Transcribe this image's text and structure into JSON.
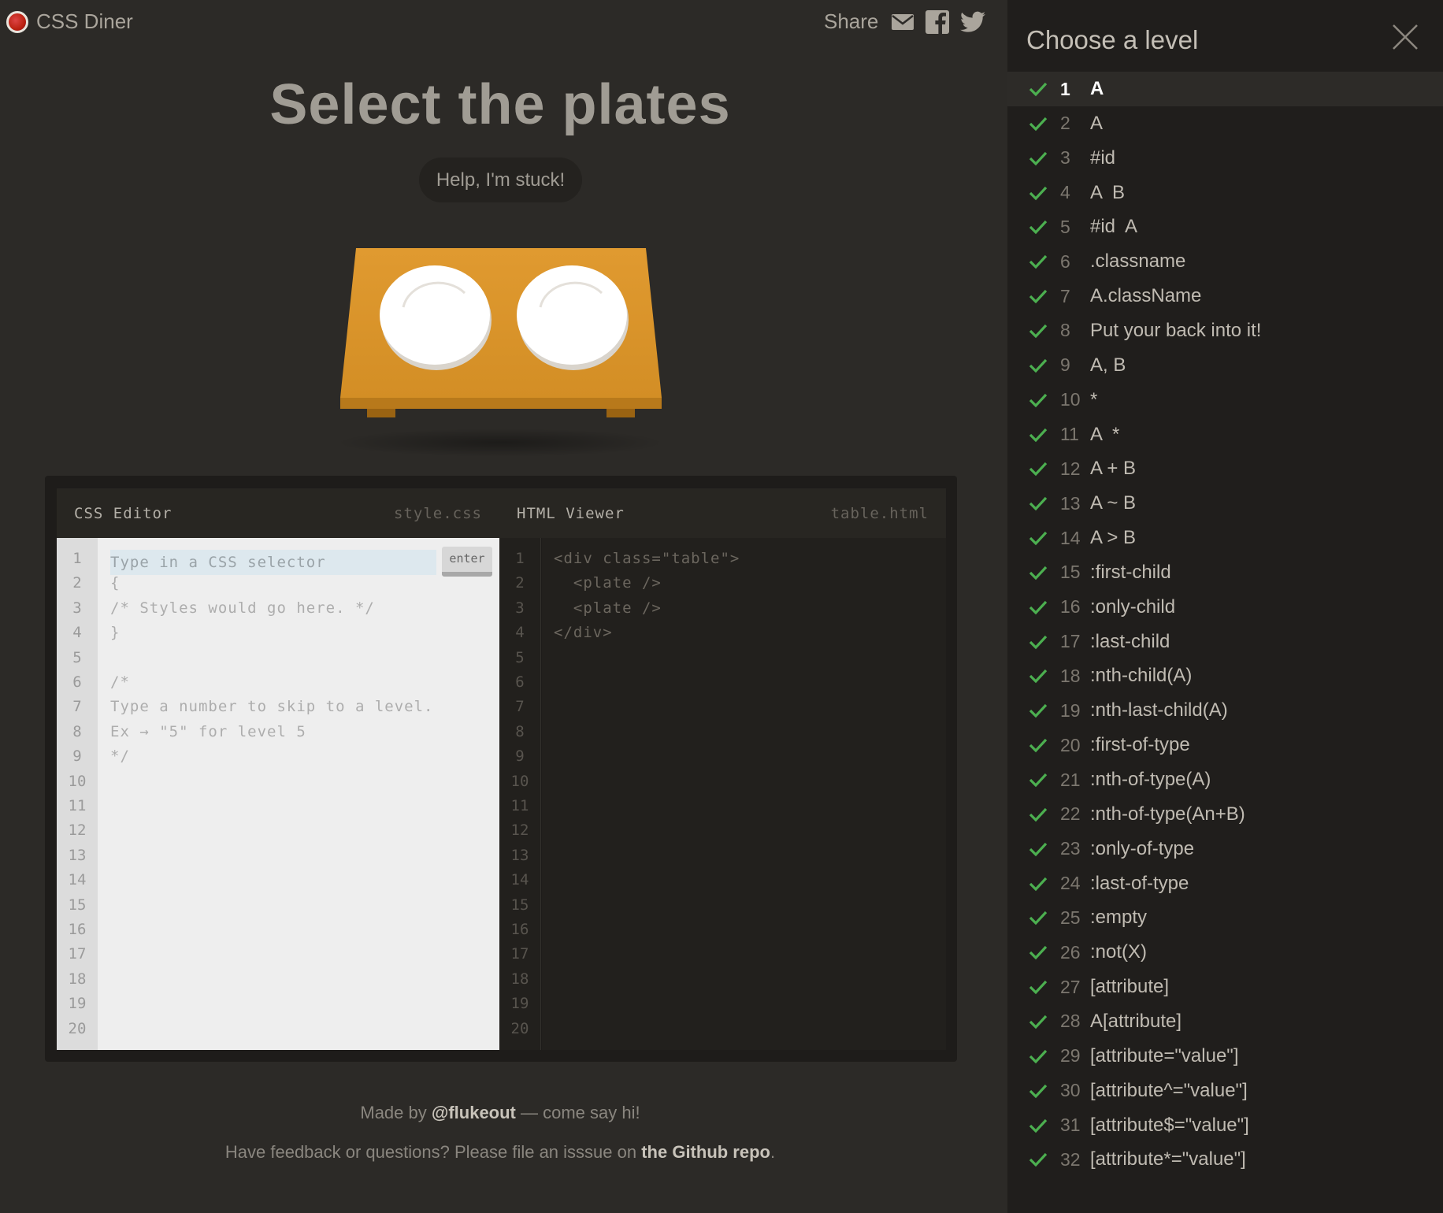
{
  "header": {
    "app_title": "CSS Diner",
    "share_label": "Share"
  },
  "main": {
    "title": "Select the plates",
    "help_label": "Help, I'm stuck!"
  },
  "editor": {
    "css_panel_name": "CSS Editor",
    "css_file": "style.css",
    "html_panel_name": "HTML Viewer",
    "html_file": "table.html",
    "input_placeholder": "Type in a CSS selector",
    "enter_label": "enter",
    "css_lines": [
      "{",
      "/* Styles would go here. */",
      "}",
      "",
      "/*",
      "Type a number to skip to a level.",
      "Ex → \"5\" for level 5",
      "*/"
    ],
    "html_lines": [
      "<div class=\"table\">",
      "  <plate />",
      "  <plate />",
      "</div>"
    ],
    "line_numbers": [
      "1",
      "2",
      "3",
      "4",
      "5",
      "6",
      "7",
      "8",
      "9",
      "10",
      "11",
      "12",
      "13",
      "14",
      "15",
      "16",
      "17",
      "18",
      "19",
      "20"
    ]
  },
  "footer": {
    "made_by_prefix": "Made by ",
    "made_by_handle": "@flukeout",
    "made_by_suffix": " — come say hi!",
    "feedback_prefix": "Have feedback or questions? Please file an isssue on ",
    "feedback_link": "the Github repo",
    "feedback_suffix": "."
  },
  "sidebar": {
    "title": "Choose a level",
    "current_level": 1,
    "check_color": "#4caf50",
    "levels": [
      {
        "num": "1",
        "name": "A"
      },
      {
        "num": "2",
        "name": "A"
      },
      {
        "num": "3",
        "name": "#id"
      },
      {
        "num": "4",
        "name": "A  B"
      },
      {
        "num": "5",
        "name": "#id  A"
      },
      {
        "num": "6",
        "name": ".classname"
      },
      {
        "num": "7",
        "name": "A.className"
      },
      {
        "num": "8",
        "name": "Put your back into it!"
      },
      {
        "num": "9",
        "name": "A, B"
      },
      {
        "num": "10",
        "name": "*"
      },
      {
        "num": "11",
        "name": "A  *"
      },
      {
        "num": "12",
        "name": "A + B"
      },
      {
        "num": "13",
        "name": "A ~ B"
      },
      {
        "num": "14",
        "name": "A > B"
      },
      {
        "num": "15",
        "name": ":first-child"
      },
      {
        "num": "16",
        "name": ":only-child"
      },
      {
        "num": "17",
        "name": ":last-child"
      },
      {
        "num": "18",
        "name": ":nth-child(A)"
      },
      {
        "num": "19",
        "name": ":nth-last-child(A)"
      },
      {
        "num": "20",
        "name": ":first-of-type"
      },
      {
        "num": "21",
        "name": ":nth-of-type(A)"
      },
      {
        "num": "22",
        "name": ":nth-of-type(An+B)"
      },
      {
        "num": "23",
        "name": ":only-of-type"
      },
      {
        "num": "24",
        "name": ":last-of-type"
      },
      {
        "num": "25",
        "name": ":empty"
      },
      {
        "num": "26",
        "name": ":not(X)"
      },
      {
        "num": "27",
        "name": "[attribute]"
      },
      {
        "num": "28",
        "name": "A[attribute]"
      },
      {
        "num": "29",
        "name": "[attribute=\"value\"]"
      },
      {
        "num": "30",
        "name": "[attribute^=\"value\"]"
      },
      {
        "num": "31",
        "name": "[attribute$=\"value\"]"
      },
      {
        "num": "32",
        "name": "[attribute*=\"value\"]"
      }
    ]
  }
}
